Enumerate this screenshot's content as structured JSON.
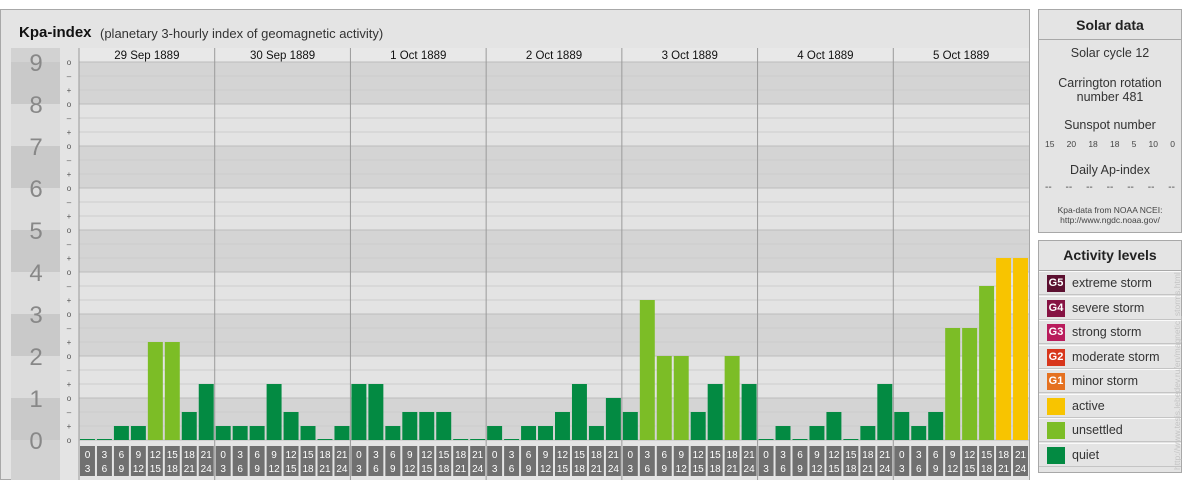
{
  "header": {
    "title": "Kpa-index",
    "subtitle": "(planetary 3-hourly index of geomagnetic activity)"
  },
  "chart_data": {
    "type": "bar",
    "title": "Kpa-index",
    "subtitle": "(planetary 3-hourly index of geomagnetic activity)",
    "ylim": [
      0,
      9
    ],
    "y_tick_labels": [
      "0",
      "1",
      "2",
      "3",
      "4",
      "5",
      "6",
      "7",
      "8",
      "9"
    ],
    "sub_tick_labels": [
      "–",
      "o",
      "+"
    ],
    "days": [
      "29 Sep 1889",
      "30 Sep 1889",
      "1 Oct 1889",
      "2 Oct 1889",
      "3 Oct 1889",
      "4 Oct 1889",
      "5 Oct 1889"
    ],
    "interval_start_labels": [
      "0",
      "3",
      "6",
      "9",
      "12",
      "15",
      "18",
      "21"
    ],
    "interval_end_labels": [
      "3",
      "6",
      "9",
      "12",
      "15",
      "18",
      "21",
      "24"
    ],
    "values": [
      [
        0,
        0,
        0.333,
        0.333,
        2.333,
        2.333,
        0.667,
        1.333
      ],
      [
        0.333,
        0.333,
        0.333,
        1.333,
        0.667,
        0.333,
        0,
        0.333
      ],
      [
        1.333,
        1.333,
        0.333,
        0.667,
        0.667,
        0.667,
        0,
        0
      ],
      [
        0.333,
        0,
        0.333,
        0.333,
        0.667,
        1.333,
        0.333,
        1
      ],
      [
        0.667,
        3.333,
        2,
        2,
        0.667,
        1.333,
        2,
        1.333
      ],
      [
        0,
        0.333,
        0,
        0.333,
        0.667,
        0,
        0.333,
        1.333
      ],
      [
        0.667,
        0.333,
        0.667,
        2.667,
        2.667,
        3.667,
        4.333,
        4.333
      ]
    ],
    "colors": {
      "quiet": "#038a42",
      "unsettled": "#7cbd26",
      "active": "#f8c400"
    },
    "grid": true,
    "xlabel": "",
    "ylabel": ""
  },
  "solar": {
    "title": "Solar data",
    "solar_cycle": "Solar cycle 12",
    "carrington_line1": "Carrington rotation",
    "carrington_line2": "number 481",
    "sunspot_title": "Sunspot number",
    "sunspot_values": [
      "15",
      "20",
      "18",
      "18",
      "5",
      "10",
      "0"
    ],
    "ap_title": "Daily Ap-index",
    "ap_values": [
      "--",
      "--",
      "--",
      "--",
      "--",
      "--",
      "--"
    ],
    "source_line1": "Kpa-data from NOAA NCEI:",
    "source_line2": "http://www.ngdc.noaa.gov/"
  },
  "legend": {
    "title": "Activity levels",
    "items": [
      {
        "code": "G5",
        "label": "extreme storm",
        "color": "#5c1030"
      },
      {
        "code": "G4",
        "label": "severe storm",
        "color": "#861343"
      },
      {
        "code": "G3",
        "label": "strong storm",
        "color": "#b91c5c"
      },
      {
        "code": "G2",
        "label": "moderate storm",
        "color": "#d8361c"
      },
      {
        "code": "G1",
        "label": "minor storm",
        "color": "#e57120"
      },
      {
        "code": "",
        "label": "active",
        "color": "#f8c400"
      },
      {
        "code": "",
        "label": "unsettled",
        "color": "#7cbd26"
      },
      {
        "code": "",
        "label": "quiet",
        "color": "#038a42"
      }
    ]
  },
  "credit": "http://www.tesis.lebedev.ru/en/magnetic_storms.html"
}
